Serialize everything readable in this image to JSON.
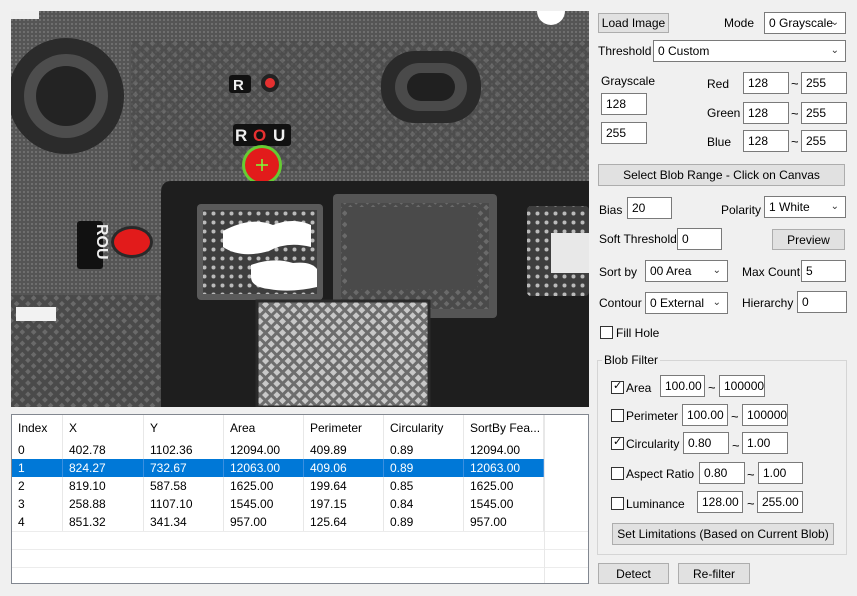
{
  "canvas": {},
  "toolbar": {
    "load_image": "Load Image",
    "mode_label": "Mode",
    "mode_value": "0 Grayscale",
    "threshold_label": "Threshold",
    "threshold_value": "0 Custom"
  },
  "gray": {
    "label": "Grayscale",
    "low": "128",
    "high": "255"
  },
  "rgb": {
    "red_label": "Red",
    "red_low": "128",
    "red_high": "255",
    "green_label": "Green",
    "green_low": "128",
    "green_high": "255",
    "blue_label": "Blue",
    "blue_low": "128",
    "blue_high": "255",
    "tilde": "~"
  },
  "select_blob_range": "Select Blob Range - Click on Canvas",
  "bias": {
    "label": "Bias",
    "value": "20"
  },
  "polarity": {
    "label": "Polarity",
    "value": "1 White"
  },
  "soft_threshold": {
    "label": "Soft Threshold",
    "value": "0"
  },
  "preview": "Preview",
  "sortby": {
    "label": "Sort by",
    "value": "00 Area"
  },
  "maxcount": {
    "label": "Max Count",
    "value": "5"
  },
  "contour": {
    "label": "Contour",
    "value": "0 External"
  },
  "hierarchy": {
    "label": "Hierarchy",
    "value": "0"
  },
  "fill_hole": {
    "label": "Fill Hole",
    "checked": false
  },
  "blob_filter": {
    "title": "Blob Filter",
    "area": {
      "label": "Area",
      "checked": true,
      "min": "100.00",
      "max": "100000."
    },
    "perimeter": {
      "label": "Perimeter",
      "checked": false,
      "min": "100.00",
      "max": "100000."
    },
    "circularity": {
      "label": "Circularity",
      "checked": true,
      "min": "0.80",
      "max": "1.00"
    },
    "aspect_ratio": {
      "label": "Aspect Ratio",
      "checked": false,
      "min": "0.80",
      "max": "1.00"
    },
    "luminance": {
      "label": "Luminance",
      "checked": false,
      "min": "128.00",
      "max": "255.00"
    },
    "set_limitations": "Set Limitations (Based on Current Blob)"
  },
  "detect": "Detect",
  "refilter": "Re-filter",
  "chart_data": {
    "type": "table",
    "columns": [
      "Index",
      "X",
      "Y",
      "Area",
      "Perimeter",
      "Circularity",
      "SortBy Fea..."
    ],
    "rows": [
      [
        "0",
        "402.78",
        "1102.36",
        "12094.00",
        "409.89",
        "0.89",
        "12094.00"
      ],
      [
        "1",
        "824.27",
        "732.67",
        "12063.00",
        "409.06",
        "0.89",
        "12063.00"
      ],
      [
        "2",
        "819.10",
        "587.58",
        "1625.00",
        "199.64",
        "0.85",
        "1625.00"
      ],
      [
        "3",
        "258.88",
        "1107.10",
        "1545.00",
        "197.15",
        "0.84",
        "1545.00"
      ],
      [
        "4",
        "851.32",
        "341.34",
        "957.00",
        "125.64",
        "0.89",
        "957.00"
      ]
    ],
    "selected_row": 1
  }
}
